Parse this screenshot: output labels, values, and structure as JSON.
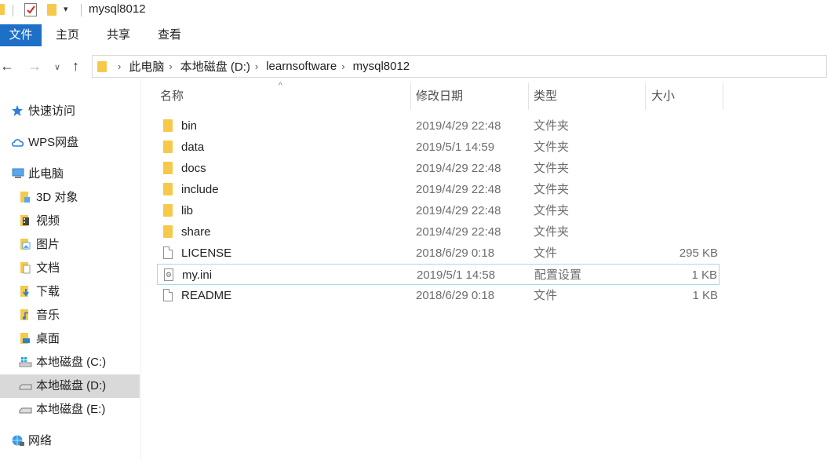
{
  "window": {
    "title": "mysql8012",
    "quick_access_dropdown": "▾"
  },
  "ribbon": {
    "file": "文件",
    "home": "主页",
    "share": "共享",
    "view": "查看"
  },
  "nav": {
    "back_icon": "←",
    "forward_icon": "→",
    "recent_icon": "∨",
    "up_icon": "↑",
    "breadcrumb": [
      "此电脑",
      "本地磁盘 (D:)",
      "learnsoftware",
      "mysql8012"
    ],
    "crumb_separator": "›"
  },
  "sidebar": {
    "items": [
      {
        "label": "快速访问",
        "icon": "star-icon"
      },
      {
        "label": "WPS网盘",
        "icon": "cloud-icon"
      },
      {
        "label": "此电脑",
        "icon": "computer-icon"
      },
      {
        "label": "3D 对象",
        "icon": "3d-objects-icon"
      },
      {
        "label": "视频",
        "icon": "video-icon"
      },
      {
        "label": "图片",
        "icon": "pictures-icon"
      },
      {
        "label": "文档",
        "icon": "documents-icon"
      },
      {
        "label": "下载",
        "icon": "download-icon"
      },
      {
        "label": "音乐",
        "icon": "music-icon"
      },
      {
        "label": "桌面",
        "icon": "desktop-icon"
      },
      {
        "label": "本地磁盘 (C:)",
        "icon": "windows-drive-icon"
      },
      {
        "label": "本地磁盘 (D:)",
        "icon": "drive-icon",
        "selected": true
      },
      {
        "label": "本地磁盘 (E:)",
        "icon": "drive-icon"
      },
      {
        "label": "网络",
        "icon": "network-icon"
      }
    ]
  },
  "columns": {
    "name": "名称",
    "date": "修改日期",
    "type": "类型",
    "size": "大小",
    "sort_indicator": "^"
  },
  "files": [
    {
      "name": "bin",
      "date": "2019/4/29 22:48",
      "type": "文件夹",
      "size": "",
      "icon": "folder-icon"
    },
    {
      "name": "data",
      "date": "2019/5/1 14:59",
      "type": "文件夹",
      "size": "",
      "icon": "folder-icon"
    },
    {
      "name": "docs",
      "date": "2019/4/29 22:48",
      "type": "文件夹",
      "size": "",
      "icon": "folder-icon"
    },
    {
      "name": "include",
      "date": "2019/4/29 22:48",
      "type": "文件夹",
      "size": "",
      "icon": "folder-icon"
    },
    {
      "name": "lib",
      "date": "2019/4/29 22:48",
      "type": "文件夹",
      "size": "",
      "icon": "folder-icon"
    },
    {
      "name": "share",
      "date": "2019/4/29 22:48",
      "type": "文件夹",
      "size": "",
      "icon": "folder-icon"
    },
    {
      "name": "LICENSE",
      "date": "2018/6/29 0:18",
      "type": "文件",
      "size": "295 KB",
      "icon": "file-icon"
    },
    {
      "name": "my.ini",
      "date": "2019/5/1 14:58",
      "type": "配置设置",
      "size": "1 KB",
      "icon": "config-file-icon",
      "focused": true
    },
    {
      "name": "README",
      "date": "2018/6/29 0:18",
      "type": "文件",
      "size": "1 KB",
      "icon": "file-icon"
    }
  ],
  "colors": {
    "file_tab": "#1e6fc8",
    "folder": "#f6c94a",
    "selection": "#d9d9d9",
    "focus_border": "#a7d7f0"
  }
}
